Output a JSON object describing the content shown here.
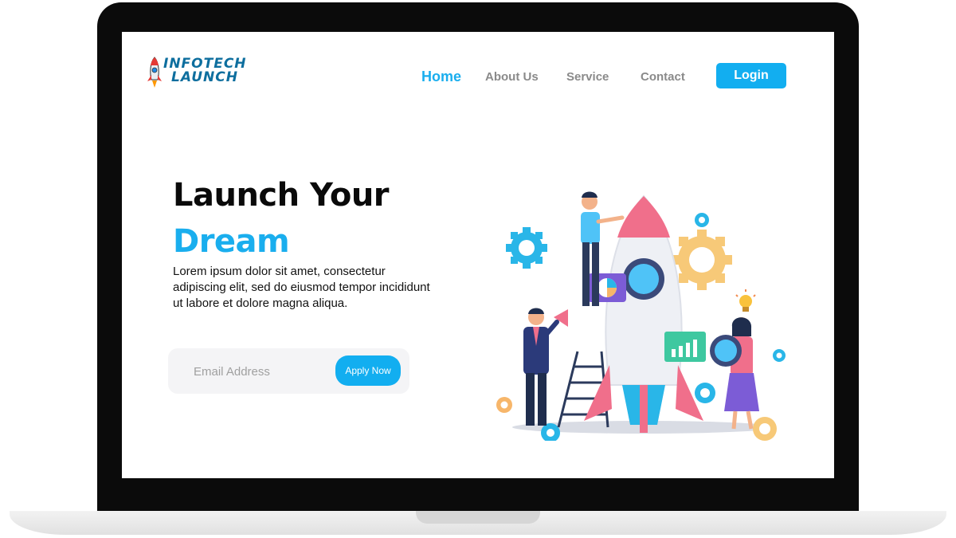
{
  "brand": {
    "line1": "INFOTECH",
    "line2": "LAUNCH",
    "icon": "rocket-icon",
    "color": "#0d6e9e"
  },
  "nav": {
    "items": [
      {
        "label": "Home",
        "active": true
      },
      {
        "label": "About Us",
        "active": false
      },
      {
        "label": "Service",
        "active": false
      },
      {
        "label": "Contact",
        "active": false
      }
    ],
    "login_label": "Login"
  },
  "hero": {
    "title_line1": "Launch Your",
    "title_line2": "Dream",
    "description": "Lorem ipsum dolor sit amet, consectetur adipiscing elit, sed do eiusmod tempor incididunt ut labore et dolore magna aliqua.",
    "email_placeholder": "Email Address",
    "apply_label": "Apply Now"
  },
  "illustration": {
    "subject": "rocket-launch-illustration",
    "elements": [
      "rocket",
      "ladder",
      "person-on-ladder",
      "businessman-with-megaphone",
      "woman-holding-porthole",
      "gears",
      "pie-chart-card",
      "bar-chart-card",
      "lightbulb-icon"
    ]
  },
  "colors": {
    "accent": "#1aaeee",
    "button": "#12aef0",
    "nav_inactive": "#8a8a8a",
    "heading": "#0a0a0a",
    "frame": "#0b0b0b"
  }
}
